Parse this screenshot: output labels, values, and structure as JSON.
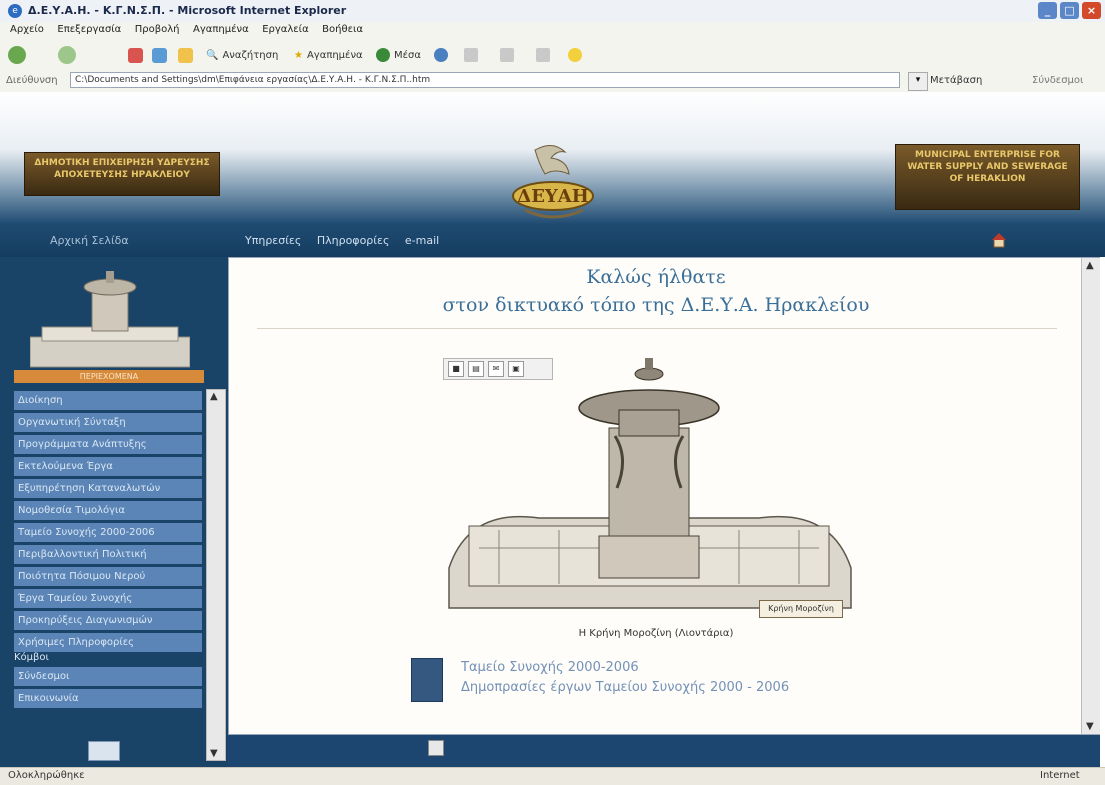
{
  "window": {
    "title": "Δ.Ε.Υ.Α.Η. - Κ.Γ.Ν.Σ.Π. - Microsoft Internet Explorer",
    "controls": [
      "_",
      "□",
      "×"
    ]
  },
  "menubar": [
    "Αρχείο",
    "Επεξεργασία",
    "Προβολή",
    "Αγαπημένα",
    "Εργαλεία",
    "Βοήθεια"
  ],
  "toolbar": {
    "search_label": "Αναζήτηση",
    "favorites_label": "Αγαπημένα",
    "media_label": "Μέσα"
  },
  "address": {
    "label": "Διεύθυνση",
    "value": "C:\\Documents and Settings\\dm\\Επιφάνεια εργασίας\\Δ.Ε.Υ.Α.Η. - Κ.Γ.Ν.Σ.Π..htm",
    "links_label": "Μετάβαση",
    "extra_label": "Σύνδεσμοι"
  },
  "header": {
    "left_logo_text": "ΔΗΜΟΤΙΚΗ ΕΠΙΧΕΙΡΗΣΗ ΥΔΡΕΥΣΗΣ ΑΠΟΧΕΤΕΥΣΗΣ ΗΡΑΚΛΕΙΟΥ",
    "right_logo_text": "MUNICIPAL ENTERPRISE FOR WATER SUPPLY AND SEWERAGE OF HERAKLION",
    "center_logo_text": "ΔΕΥΑΗ",
    "left_nav_text": "Αρχική Σελίδα",
    "nav": [
      "Υπηρεσίες",
      "Πληροφορίες",
      "e-mail"
    ]
  },
  "sidebar": {
    "section_title": "ΠΕΡΙΕΧΟΜΕΝΑ",
    "items": [
      "Διοίκηση",
      "Οργανωτική Σύνταξη",
      "Προγράμματα Ανάπτυξης",
      "Εκτελούμενα Έργα",
      "Εξυπηρέτηση Καταναλωτών",
      "Νομοθεσία Τιμολόγια",
      "Ταμείο Συνοχής 2000-2006",
      "Περιβαλλοντική Πολιτική",
      "Ποιότητα Πόσιμου Νερού",
      "Έργα Ταμείου Συνοχής",
      "Προκηρύξεις Διαγωνισμών",
      "Χρήσιμες Πληροφορίες"
    ],
    "links_title": "Κόμβοι",
    "links": [
      "Σύνδεσμοι",
      "Επικοινωνία"
    ]
  },
  "main": {
    "welcome_line1": "Καλώς ήλθατε",
    "welcome_line2": "στον δικτυακό τόπο της Δ.Ε.Υ.Α. Ηρακλείου",
    "image_label": "Κρήνη Μοροζίνη",
    "caption": "Η Κρήνη Μοροζίνη (Λιοντάρια)",
    "fund_link1": "Ταμείο Συνοχής 2000-2006",
    "fund_link2": "Δημοπρασίες έργων Ταμείου Συνοχής 2000 - 2006"
  },
  "status": {
    "left_text": "Ολοκληρώθηκε",
    "right_text": "Internet"
  },
  "colors": {
    "header_blue": "#153c60",
    "sidebar_item": "#5a85b6",
    "accent_orange": "#d78b3a",
    "welcome_text": "#3a6f99"
  }
}
